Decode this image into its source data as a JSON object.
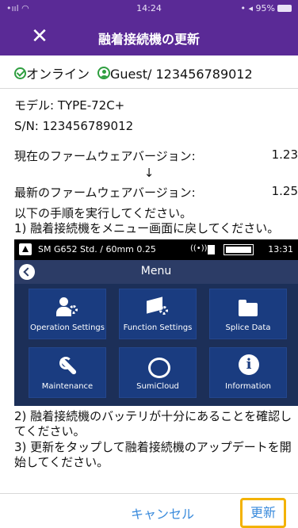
{
  "status_bar": {
    "carrier": "•ııl ",
    "wifi": "◠",
    "time": "14:24",
    "location": "• ◂",
    "battery": "95%"
  },
  "header": {
    "title": "融着接続機の更新",
    "close_glyph": "✕"
  },
  "connection": {
    "status": "オンライン",
    "user": "Guest/",
    "user_id": "123456789012"
  },
  "device_info": {
    "model_label": "モデル:",
    "model": "TYPE-72C+",
    "sn_label": "S/N:",
    "sn": "123456789012"
  },
  "firmware": {
    "current_label": "現在のファームウェアバージョン:",
    "current_value": "1.23",
    "arrow": "↓",
    "latest_label": "最新のファームウェアバージョン:",
    "latest_value": "1.25"
  },
  "instructions": {
    "intro": "以下の手順を実行してください。",
    "step1": "1) 融着接続機をメニュー画面に戻してください。",
    "step2": "2) 融着接続機のバッテリが十分にあることを確認してください。",
    "step3": "3) 更新をタップして融着接続機のアップデートを開始してください。"
  },
  "device_screen": {
    "model": "SM G652 Std. / 60mm 0.25",
    "wifi": "((•))",
    "time": "13:31",
    "menu_title": "Menu",
    "tiles": [
      {
        "label": "Operation Settings",
        "icon": "person-gear-icon"
      },
      {
        "label": "Function Settings",
        "icon": "box-gear-icon"
      },
      {
        "label": "Splice Data",
        "icon": "folder-icon"
      },
      {
        "label": "Maintenance",
        "icon": "wrench-icon"
      },
      {
        "label": "SumiCloud",
        "icon": "cloud-icon"
      },
      {
        "label": "Information",
        "icon": "info-icon"
      }
    ]
  },
  "footer": {
    "cancel": "キャンセル",
    "update": "更新"
  },
  "colors": {
    "header_bg": "#5a2a96",
    "accent_link": "#3a8bdc",
    "ok_green": "#2e9e3f",
    "highlight": "#f3b200"
  }
}
